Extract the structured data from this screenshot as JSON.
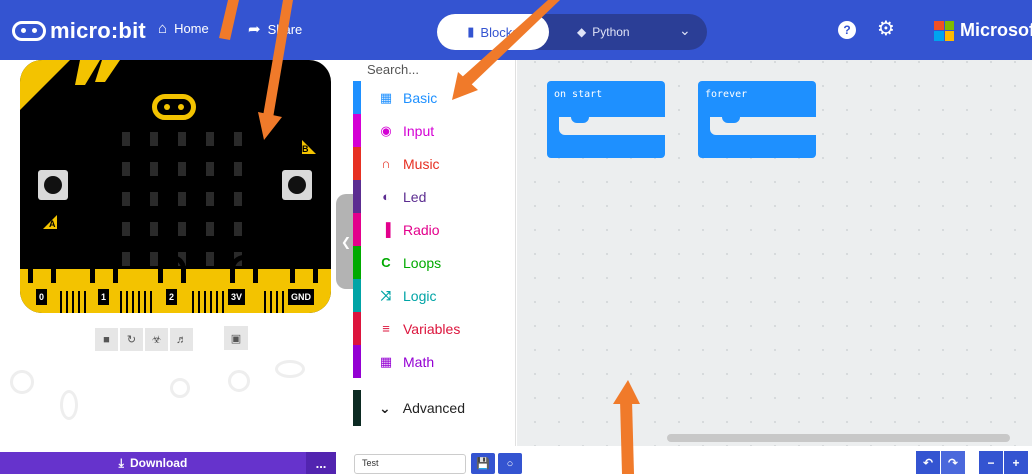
{
  "header": {
    "logo_text": "micro:bit",
    "home_label": "Home",
    "share_label": "Share",
    "blocks_label": "Blocks",
    "python_label": "Python",
    "microsoft_label": "Microsoft",
    "colors": {
      "bar": "#3454d1",
      "toggle": "#2b3e96"
    }
  },
  "simulator": {
    "pins": [
      "0",
      "1",
      "2",
      "3V",
      "GND"
    ],
    "button_a": "A",
    "button_b": "B",
    "toolbar_icons": [
      "stop-icon",
      "restart-icon",
      "debug-icon",
      "mute-icon",
      "fullscreen-icon"
    ]
  },
  "toolbox": {
    "search_placeholder": "Search...",
    "categories": [
      {
        "label": "Basic",
        "color": "#1e90ff",
        "icon": "grid-icon"
      },
      {
        "label": "Input",
        "color": "#d400d4",
        "icon": "target-icon"
      },
      {
        "label": "Music",
        "color": "#e63022",
        "icon": "headphones-icon"
      },
      {
        "label": "Led",
        "color": "#5c2d91",
        "icon": "toggle-icon"
      },
      {
        "label": "Radio",
        "color": "#e3008c",
        "icon": "signal-bars-icon"
      },
      {
        "label": "Loops",
        "color": "#00aa00",
        "icon": "refresh-icon"
      },
      {
        "label": "Logic",
        "color": "#00a4a6",
        "icon": "shuffle-icon"
      },
      {
        "label": "Variables",
        "color": "#dc143c",
        "icon": "lines-icon"
      },
      {
        "label": "Math",
        "color": "#9400d3",
        "icon": "calculator-icon"
      }
    ],
    "advanced_label": "Advanced"
  },
  "workspace": {
    "blocks": [
      {
        "label": "on start"
      },
      {
        "label": "forever"
      }
    ]
  },
  "bottom": {
    "download_label": "Download",
    "more_label": "...",
    "project_name": "Test"
  }
}
